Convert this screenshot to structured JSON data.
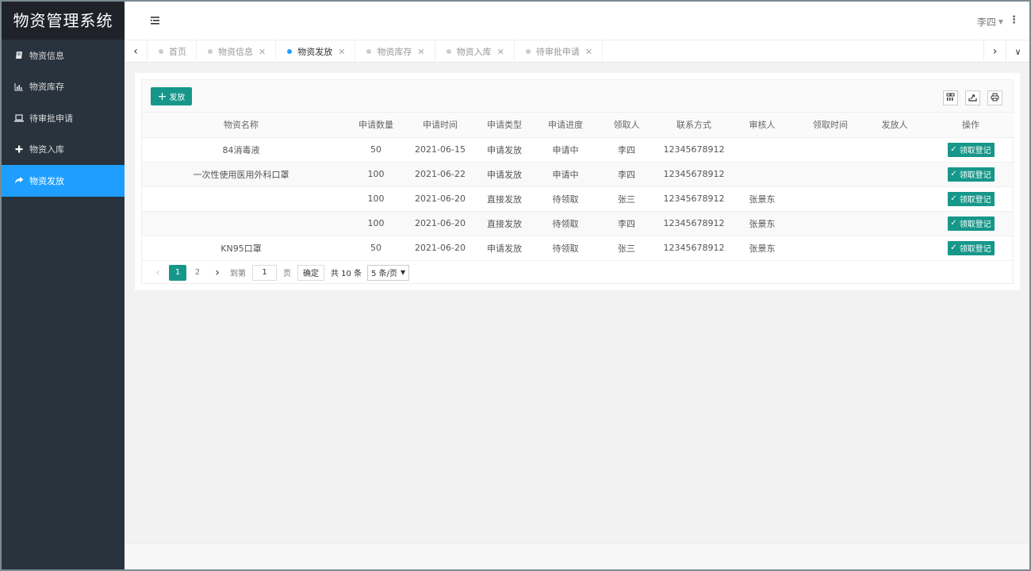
{
  "app": {
    "title": "物资管理系统"
  },
  "sidebar": {
    "items": [
      {
        "label": "物资信息",
        "icon": "book-icon"
      },
      {
        "label": "物资库存",
        "icon": "bar-chart-icon"
      },
      {
        "label": "待审批申请",
        "icon": "laptop-icon"
      },
      {
        "label": "物资入库",
        "icon": "plus-icon"
      },
      {
        "label": "物资发放",
        "icon": "share-icon",
        "active": true
      }
    ]
  },
  "header": {
    "user": "李四",
    "caret": "▼",
    "more": "⋮"
  },
  "tabs": [
    {
      "label": "首页",
      "closable": false
    },
    {
      "label": "物资信息",
      "closable": true
    },
    {
      "label": "物资发放",
      "closable": true,
      "active": true
    },
    {
      "label": "物资库存",
      "closable": true
    },
    {
      "label": "物资入库",
      "closable": true
    },
    {
      "label": "待审批申请",
      "closable": true
    }
  ],
  "toolbar": {
    "add_label": "发放"
  },
  "table": {
    "columns": [
      "物资名称",
      "申请数量",
      "申请时间",
      "申请类型",
      "申请进度",
      "领取人",
      "联系方式",
      "审核人",
      "领取时间",
      "发放人",
      "操作"
    ],
    "rows": [
      [
        "84消毒液",
        "50",
        "2021-06-15",
        "申请发放",
        "申请中",
        "李四",
        "12345678912",
        "",
        "",
        ""
      ],
      [
        "一次性使用医用外科口罩",
        "100",
        "2021-06-22",
        "申请发放",
        "申请中",
        "李四",
        "12345678912",
        "",
        "",
        ""
      ],
      [
        "",
        "100",
        "2021-06-20",
        "直接发放",
        "待领取",
        "张三",
        "12345678912",
        "张景东",
        "",
        ""
      ],
      [
        "",
        "100",
        "2021-06-20",
        "直接发放",
        "待领取",
        "李四",
        "12345678912",
        "张景东",
        "",
        ""
      ],
      [
        "KN95口罩",
        "50",
        "2021-06-20",
        "申请发放",
        "待领取",
        "张三",
        "12345678912",
        "张景东",
        "",
        ""
      ]
    ],
    "row_action": "领取登记"
  },
  "pagination": {
    "pages": [
      "1",
      "2"
    ],
    "current": "1",
    "goto_prefix": "到第",
    "goto_value": "1",
    "goto_suffix": "页",
    "confirm": "确定",
    "total": "共 10 条",
    "page_size": "5 条/页"
  }
}
